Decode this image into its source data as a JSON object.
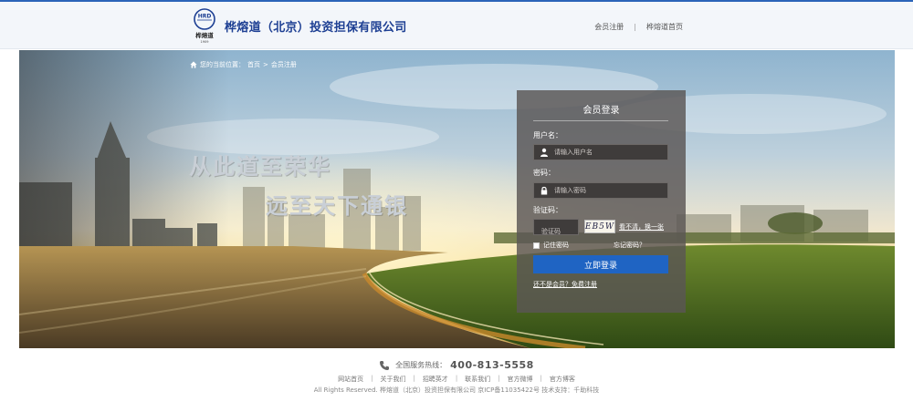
{
  "header": {
    "logo_text_top": "HRD",
    "logo_text_name": "桦熔道",
    "logo_text_year": "1909",
    "company_name": "桦熔道（北京）投资担保有限公司",
    "links": [
      {
        "label": "会员注册"
      },
      {
        "label": "桦熔道首页"
      }
    ],
    "separator": "|"
  },
  "breadcrumb": {
    "prefix": "您的当前位置：",
    "items": [
      "首页",
      "会员注册"
    ],
    "separator": ">"
  },
  "banner": {
    "slogan_line1": "从此道至荣华",
    "slogan_line2": "远至天下通银"
  },
  "login": {
    "title": "会员登录",
    "username_label": "用户名：",
    "username_placeholder": "请输入用户名",
    "password_label": "密码：",
    "password_placeholder": "请输入密码",
    "captcha_label": "验证码：",
    "captcha_placeholder": "验证码",
    "captcha_code": "EB5W",
    "captcha_refresh": "看不清，换一张",
    "remember_label": "记住密码",
    "forgot_label": "忘记密码？",
    "submit_label": "立即登录",
    "register_link": "还不是会员？免费注册"
  },
  "footer": {
    "hotline_label": "全国服务热线：",
    "hotline_number": "400-813-5558",
    "links": [
      "网站首页",
      "关于我们",
      "招聘英才",
      "联系我们",
      "官方微博",
      "官方博客"
    ],
    "separator": "|",
    "copyright": "All Rights Reserved.  桦熔道（北京）投资担保有限公司   京ICP备11035422号  技术支持：千助科技"
  },
  "colors": {
    "brand_blue": "#1d3f93",
    "button_blue": "#1f64c3",
    "panel_bg": "rgba(90,86,84,0.82)"
  }
}
